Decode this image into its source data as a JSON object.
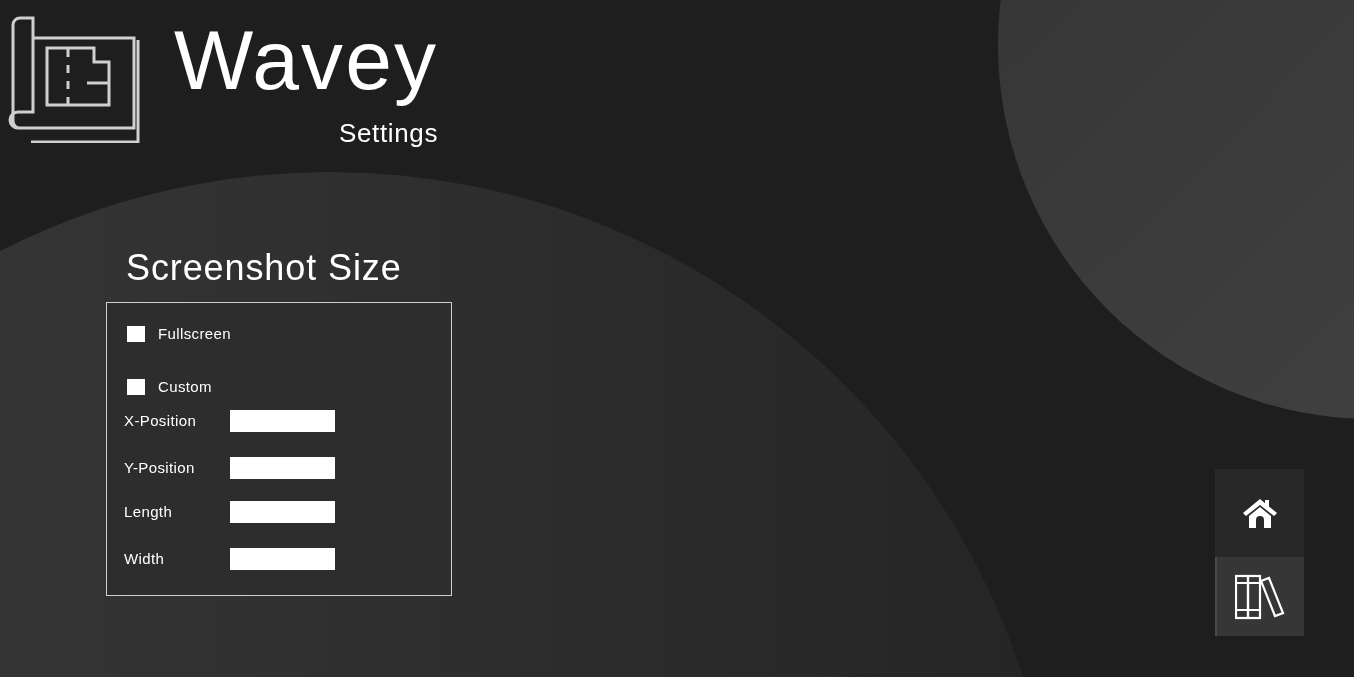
{
  "app": {
    "title": "Wavey",
    "subtitle": "Settings"
  },
  "section": {
    "title": "Screenshot Size",
    "options": [
      {
        "label": "Fullscreen",
        "checked": false
      },
      {
        "label": "Custom",
        "checked": false
      }
    ],
    "fields": [
      {
        "label": "X-Position"
      },
      {
        "label": "Y-Position"
      },
      {
        "label": "Length"
      },
      {
        "label": "Width"
      }
    ]
  },
  "nav": [
    {
      "kind": "home",
      "selected": false
    },
    {
      "kind": "library",
      "selected": true
    }
  ]
}
